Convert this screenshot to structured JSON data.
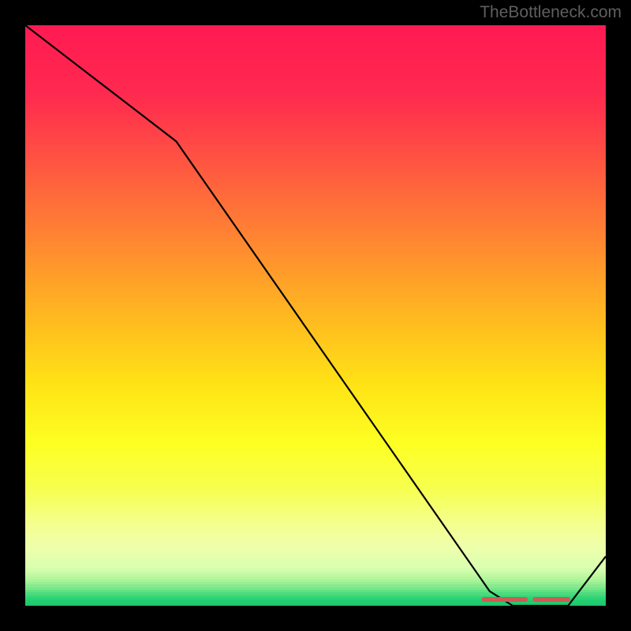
{
  "watermark": "TheBottleneck.com",
  "chart_data": {
    "type": "line",
    "title": "",
    "xlabel": "",
    "ylabel": "",
    "x": [
      0.0,
      0.26,
      0.8,
      0.84,
      0.9,
      0.935,
      1.0
    ],
    "y": [
      1.0,
      0.8,
      0.025,
      0.0,
      0.0,
      0.0,
      0.085
    ],
    "xlim": [
      0,
      1
    ],
    "ylim": [
      0,
      1
    ],
    "note": "Axes unlabeled; coordinates are normalized to the plot area. Line descends from top-left, flattens near bottom-right dwell band, then rises slightly.",
    "background_gradient": {
      "type": "vertical",
      "stops": [
        {
          "pos": 0.0,
          "color": "#ff1a52"
        },
        {
          "pos": 0.12,
          "color": "#ff2a4f"
        },
        {
          "pos": 0.25,
          "color": "#ff5a40"
        },
        {
          "pos": 0.38,
          "color": "#ff8a30"
        },
        {
          "pos": 0.5,
          "color": "#ffb820"
        },
        {
          "pos": 0.62,
          "color": "#ffe316"
        },
        {
          "pos": 0.72,
          "color": "#fdff22"
        },
        {
          "pos": 0.8,
          "color": "#f6ff50"
        },
        {
          "pos": 0.86,
          "color": "#f4ff90"
        },
        {
          "pos": 0.9,
          "color": "#eeffac"
        },
        {
          "pos": 0.935,
          "color": "#d8ffb0"
        },
        {
          "pos": 0.955,
          "color": "#b0f59a"
        },
        {
          "pos": 0.972,
          "color": "#6fe486"
        },
        {
          "pos": 0.985,
          "color": "#2fd576"
        },
        {
          "pos": 1.0,
          "color": "#18c76a"
        }
      ]
    },
    "marker_band": {
      "color": "#cf5a56",
      "y": 0.0,
      "x_start": 0.79,
      "x_end": 0.935,
      "gap_at": 0.87
    }
  }
}
